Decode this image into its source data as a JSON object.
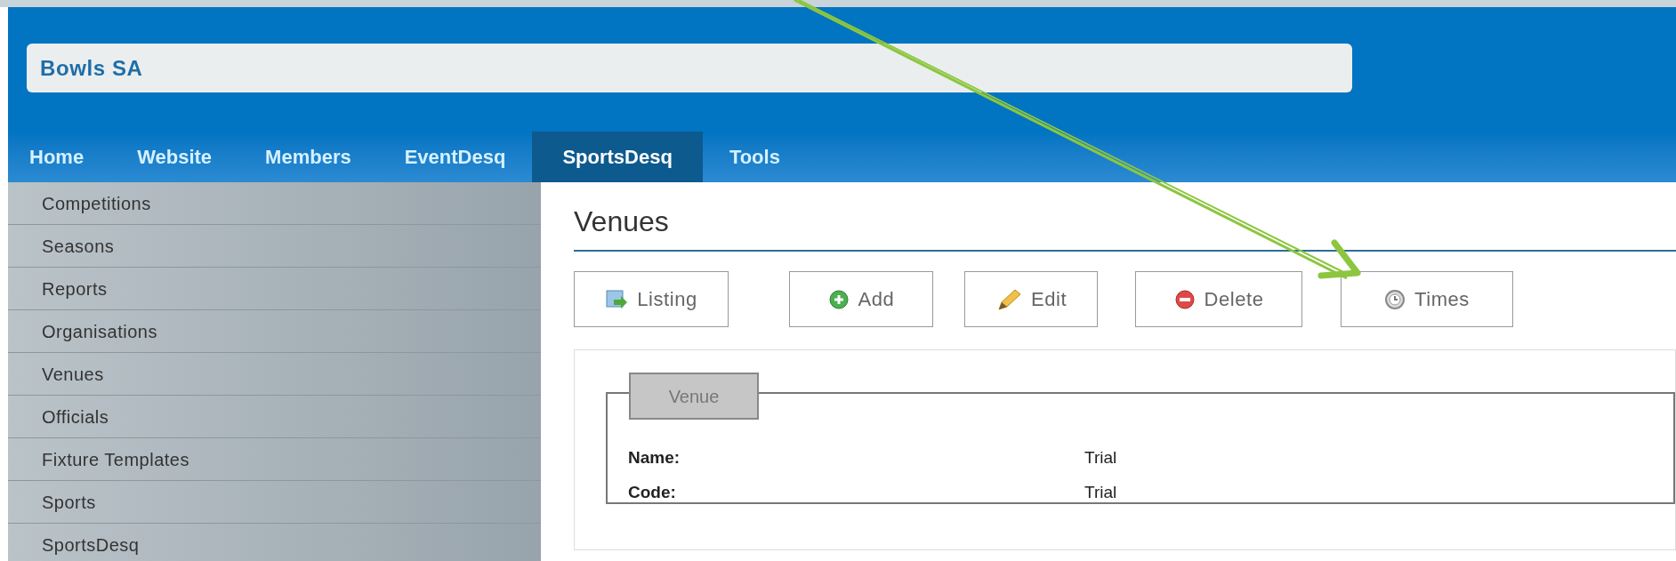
{
  "site_title": "Bowls SA",
  "nav": [
    {
      "label": "Home",
      "selected": false
    },
    {
      "label": "Website",
      "selected": false
    },
    {
      "label": "Members",
      "selected": false
    },
    {
      "label": "EventDesq",
      "selected": false
    },
    {
      "label": "SportsDesq",
      "selected": true
    },
    {
      "label": "Tools",
      "selected": false
    }
  ],
  "sidebar": {
    "items": [
      "Competitions",
      "Seasons",
      "Reports",
      "Organisations",
      "Venues",
      "Officials",
      "Fixture Templates",
      "Sports",
      "SportsDesq"
    ]
  },
  "page_title": "Venues",
  "toolbar": [
    {
      "kind": "listing",
      "label": "Listing"
    },
    {
      "kind": "add",
      "label": "Add"
    },
    {
      "kind": "edit",
      "label": "Edit"
    },
    {
      "kind": "delete",
      "label": "Delete"
    },
    {
      "kind": "times",
      "label": "Times"
    }
  ],
  "fieldset": {
    "legend": "Venue",
    "fields": [
      {
        "label": "Name:",
        "value": "Trial"
      },
      {
        "label": "Code:",
        "value": "Trial"
      }
    ]
  },
  "annotation": {
    "kind": "arrow",
    "color": "#8cc63f"
  }
}
